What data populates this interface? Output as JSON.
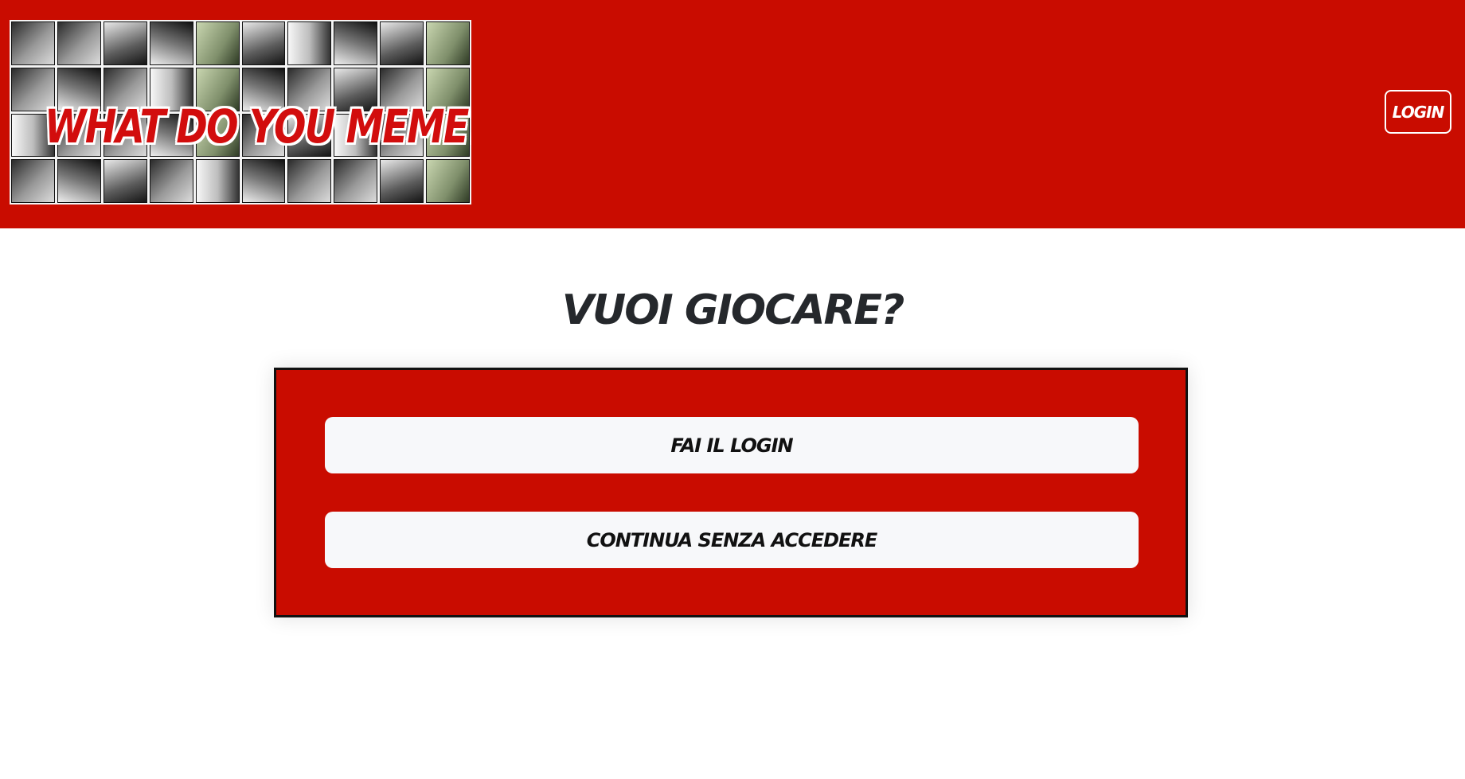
{
  "header": {
    "banner_title": "WHAT DO YOU MEME?",
    "login_label": "LOGIN",
    "background_color": "#c90c00"
  },
  "main": {
    "title": "VUOI GIOCARE?",
    "buttons": [
      {
        "label": "FAI IL LOGIN"
      },
      {
        "label": "CONTINUA SENZA ACCEDERE"
      }
    ]
  }
}
